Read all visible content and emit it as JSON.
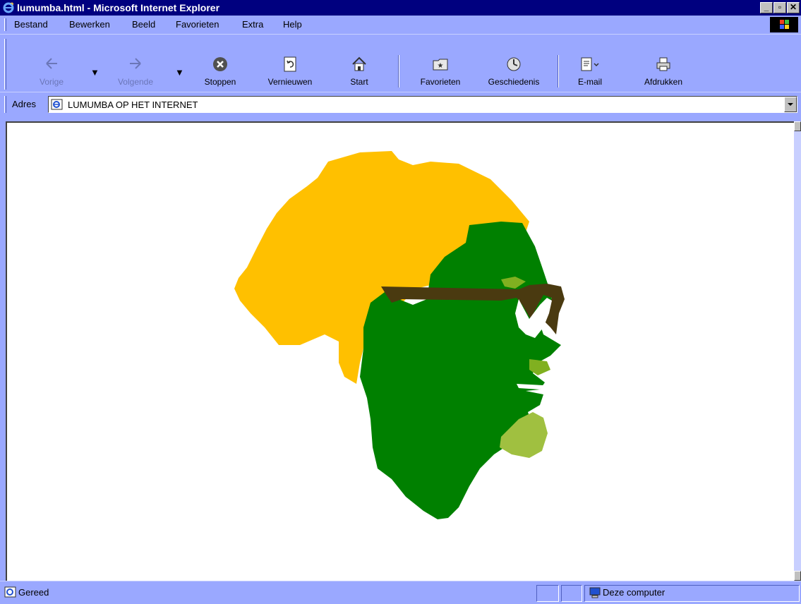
{
  "window": {
    "title": "lumumba.html - Microsoft Internet Explorer",
    "controls": {
      "minimize": "_",
      "maximize": "▫",
      "close": "✕"
    }
  },
  "menu": {
    "items": [
      "Bestand",
      "Bewerken",
      "Beeld",
      "Favorieten",
      "Extra",
      "Help"
    ]
  },
  "toolbar": {
    "back_label": "Vorige",
    "forward_label": "Volgende",
    "stop_label": "Stoppen",
    "refresh_label": "Vernieuwen",
    "home_label": "Start",
    "favorites_label": "Favorieten",
    "history_label": "Geschiedenis",
    "mail_label": "E-mail",
    "print_label": "Afdrukken"
  },
  "address": {
    "label": "Adres",
    "value": "LUMUMBA OP HET INTERNET"
  },
  "content": {
    "image": "lumumba-africa-profile-illustration",
    "colors": {
      "africa": "#ffc000",
      "face": "#008000",
      "highlight": "#a0c040",
      "glasses": "#4a3a10"
    }
  },
  "status": {
    "text": "Gereed",
    "zone": "Deze computer"
  }
}
